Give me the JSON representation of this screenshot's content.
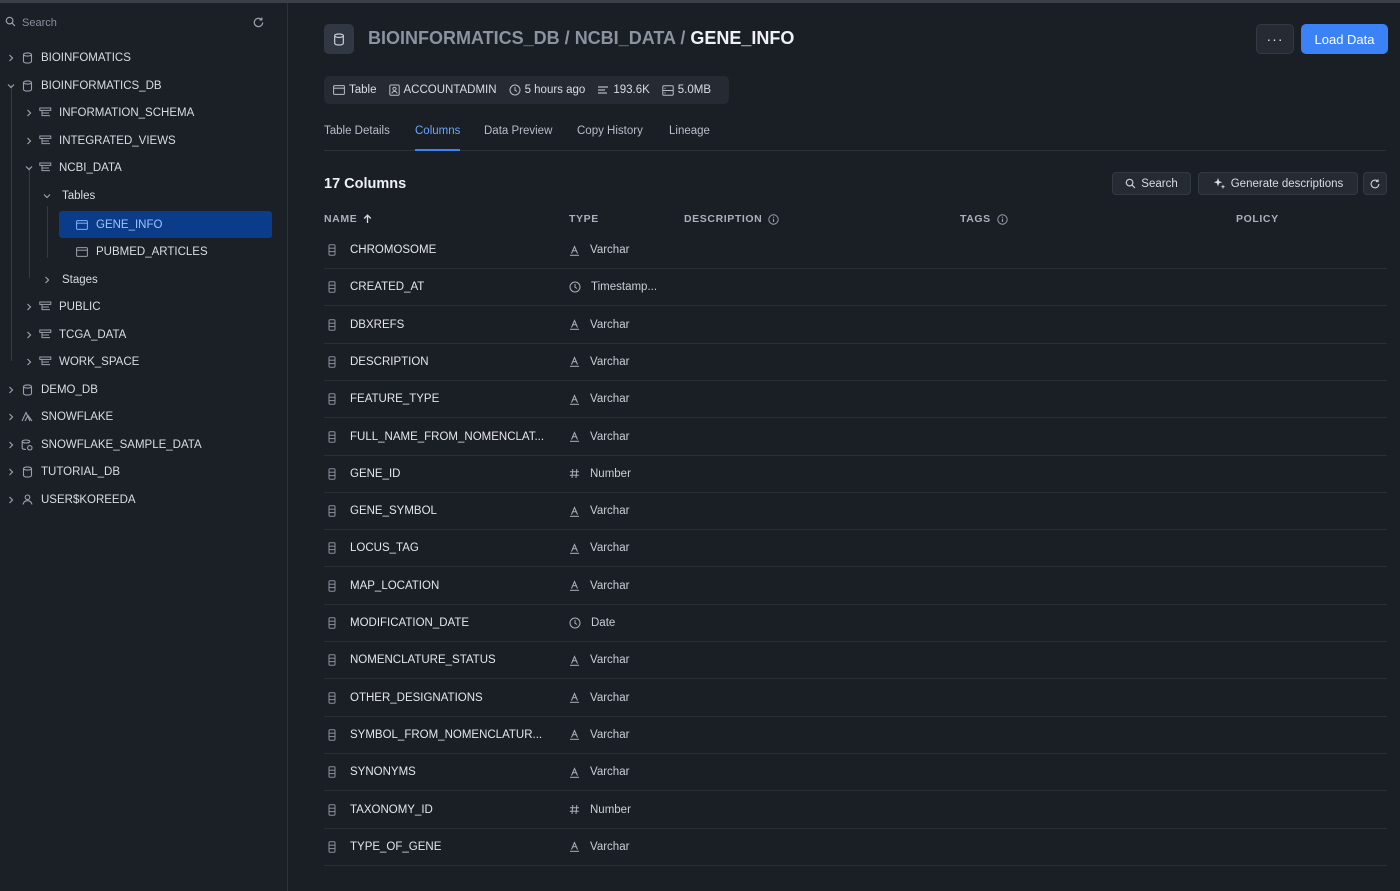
{
  "sidebar": {
    "search_placeholder": "Search",
    "items": [
      {
        "label": "BIOINFOMATICS",
        "icon": "database-icon",
        "name": "tree-item-bioinfomatics"
      },
      {
        "label": "BIOINFORMATICS_DB",
        "icon": "database-icon",
        "name": "tree-item-bioinformatics-db"
      },
      {
        "label": "INFORMATION_SCHEMA",
        "icon": "schema-icon",
        "name": "tree-item-information-schema"
      },
      {
        "label": "INTEGRATED_VIEWS",
        "icon": "schema-icon",
        "name": "tree-item-integrated-views"
      },
      {
        "label": "NCBI_DATA",
        "icon": "schema-icon",
        "name": "tree-item-ncbi-data"
      },
      {
        "label": "Tables",
        "icon": "",
        "name": "tree-item-tables"
      },
      {
        "label": "GENE_INFO",
        "icon": "table-icon",
        "name": "tree-item-gene-info"
      },
      {
        "label": "PUBMED_ARTICLES",
        "icon": "table-icon",
        "name": "tree-item-pubmed-articles"
      },
      {
        "label": "Stages",
        "icon": "",
        "name": "tree-item-stages"
      },
      {
        "label": "PUBLIC",
        "icon": "schema-icon",
        "name": "tree-item-public"
      },
      {
        "label": "TCGA_DATA",
        "icon": "schema-icon",
        "name": "tree-item-tcga-data"
      },
      {
        "label": "WORK_SPACE",
        "icon": "schema-icon",
        "name": "tree-item-work-space"
      },
      {
        "label": "DEMO_DB",
        "icon": "database-icon",
        "name": "tree-item-demo-db"
      },
      {
        "label": "SNOWFLAKE",
        "icon": "snowflake-share-icon",
        "name": "tree-item-snowflake"
      },
      {
        "label": "SNOWFLAKE_SAMPLE_DATA",
        "icon": "shared-database-icon",
        "name": "tree-item-snowflake-sample-data"
      },
      {
        "label": "TUTORIAL_DB",
        "icon": "database-icon",
        "name": "tree-item-tutorial-db"
      },
      {
        "label": "USER$KOREEDA",
        "icon": "user-icon",
        "name": "tree-item-user-koreeda"
      }
    ]
  },
  "header": {
    "breadcrumb_db": "BIOINFORMATICS_DB",
    "breadcrumb_sep": " / ",
    "breadcrumb_schema": "NCBI_DATA",
    "breadcrumb_table": "GENE_INFO",
    "more_label": "···",
    "load_button": "Load Data"
  },
  "meta": {
    "type": "Table",
    "owner": "ACCOUNTADMIN",
    "updated": "5 hours ago",
    "rows": "193.6K",
    "size": "5.0MB"
  },
  "tabs": [
    "Table Details",
    "Columns",
    "Data Preview",
    "Copy History",
    "Lineage"
  ],
  "active_tab": "Columns",
  "columns_section": {
    "count_label": "17 Columns",
    "search_button": "Search",
    "generate_button": "Generate descriptions",
    "headers": {
      "name": "NAME",
      "type": "TYPE",
      "description": "DESCRIPTION",
      "tags": "TAGS",
      "policy": "POLICY"
    }
  },
  "columns": [
    {
      "name": "CHROMOSOME",
      "type": "Varchar",
      "type_icon": "text-type-icon"
    },
    {
      "name": "CREATED_AT",
      "type": "Timestamp...",
      "type_icon": "clock-icon"
    },
    {
      "name": "DBXREFS",
      "type": "Varchar",
      "type_icon": "text-type-icon"
    },
    {
      "name": "DESCRIPTION",
      "type": "Varchar",
      "type_icon": "text-type-icon"
    },
    {
      "name": "FEATURE_TYPE",
      "type": "Varchar",
      "type_icon": "text-type-icon"
    },
    {
      "name": "FULL_NAME_FROM_NOMENCLAT...",
      "type": "Varchar",
      "type_icon": "text-type-icon"
    },
    {
      "name": "GENE_ID",
      "type": "Number",
      "type_icon": "hash-icon"
    },
    {
      "name": "GENE_SYMBOL",
      "type": "Varchar",
      "type_icon": "text-type-icon"
    },
    {
      "name": "LOCUS_TAG",
      "type": "Varchar",
      "type_icon": "text-type-icon"
    },
    {
      "name": "MAP_LOCATION",
      "type": "Varchar",
      "type_icon": "text-type-icon"
    },
    {
      "name": "MODIFICATION_DATE",
      "type": "Date",
      "type_icon": "clock-icon"
    },
    {
      "name": "NOMENCLATURE_STATUS",
      "type": "Varchar",
      "type_icon": "text-type-icon"
    },
    {
      "name": "OTHER_DESIGNATIONS",
      "type": "Varchar",
      "type_icon": "text-type-icon"
    },
    {
      "name": "SYMBOL_FROM_NOMENCLATUR...",
      "type": "Varchar",
      "type_icon": "text-type-icon"
    },
    {
      "name": "SYNONYMS",
      "type": "Varchar",
      "type_icon": "text-type-icon"
    },
    {
      "name": "TAXONOMY_ID",
      "type": "Number",
      "type_icon": "hash-icon"
    },
    {
      "name": "TYPE_OF_GENE",
      "type": "Varchar",
      "type_icon": "text-type-icon"
    }
  ],
  "colors": {
    "accent": "#3b82f6",
    "selected_bg": "#0b3c8a",
    "background": "#1a1e25"
  }
}
